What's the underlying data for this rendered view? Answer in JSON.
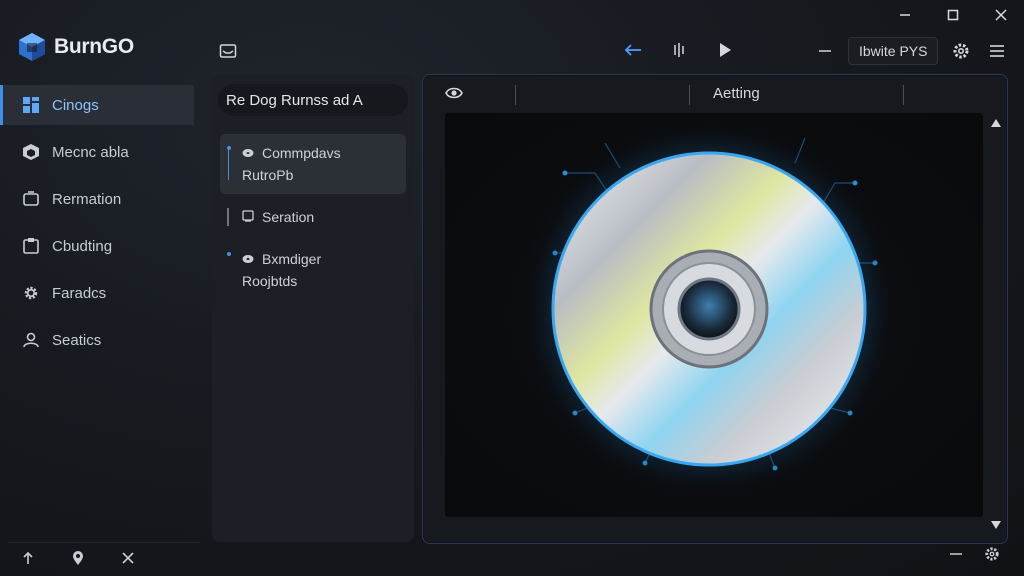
{
  "app": {
    "name": "BurnGO"
  },
  "sidebar": {
    "items": [
      {
        "label": "Cinogs",
        "icon": "grid-icon",
        "active": true
      },
      {
        "label": "Mecnc abla",
        "icon": "box-icon",
        "active": false
      },
      {
        "label": "Rermation",
        "icon": "folder-icon",
        "active": false
      },
      {
        "label": "Cbudting",
        "icon": "clipboard-icon",
        "active": false
      },
      {
        "label": "Faradcs",
        "icon": "gear-icon",
        "active": false
      },
      {
        "label": "Seatics",
        "icon": "user-icon",
        "active": false
      }
    ],
    "footer_icons": [
      "upload-icon",
      "location-pin-icon",
      "close-icon"
    ]
  },
  "toolbar": {
    "speed_label": "Ibwite PYS"
  },
  "middle_panel": {
    "title": "Re Dog Rurnss ad A",
    "items": [
      {
        "label": "Commpdavs",
        "sub": "RutroPb",
        "icon": "disc-icon",
        "selected": true
      },
      {
        "label": "Seration",
        "sub": "",
        "icon": "file-icon",
        "selected": false
      },
      {
        "label": "Bxmdiger",
        "sub": "Roojbtds",
        "icon": "disc-icon",
        "selected": false
      }
    ]
  },
  "main_panel": {
    "tab_label": "Aetting",
    "viewer_icon": "cd-disc-icon"
  },
  "colors": {
    "accent": "#3d8fe8",
    "active_text": "#8cc4ff",
    "disc_glow": "#2fa8ff"
  }
}
